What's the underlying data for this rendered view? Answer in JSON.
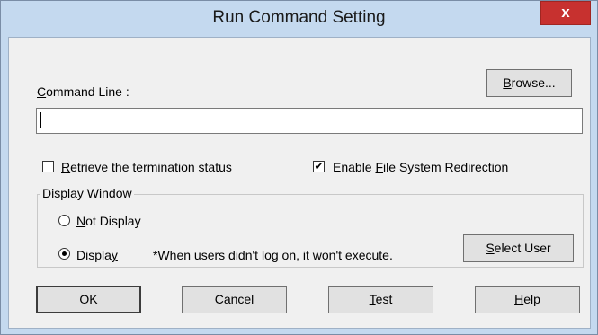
{
  "window": {
    "title": "Run Command Setting",
    "close_glyph": "x",
    "close_icon": "close-icon"
  },
  "command": {
    "label_mnemonic": "C",
    "label_rest": "ommand Line :",
    "value": ""
  },
  "browse": {
    "mnemonic": "B",
    "rest": "rowse..."
  },
  "options": {
    "retrieve": {
      "mnemonic": "R",
      "rest": "etrieve the termination status",
      "checked": false
    },
    "redirect": {
      "pre": "Enable ",
      "mnemonic": "F",
      "rest": "ile System Redirection",
      "checked": true,
      "check_glyph": "✔"
    }
  },
  "display_window": {
    "title": "Display Window",
    "not_display": {
      "mnemonic": "N",
      "rest": "ot Display",
      "selected": false
    },
    "display": {
      "pre": "Displa",
      "mnemonic": "y",
      "selected": true
    },
    "note": "*When users didn't log on, it won't execute.",
    "select_user": {
      "mnemonic": "S",
      "rest": "elect User"
    }
  },
  "buttons": {
    "ok": "OK",
    "cancel": "Cancel",
    "test": {
      "mnemonic": "T",
      "rest": "est"
    },
    "help": {
      "mnemonic": "H",
      "rest": "elp"
    }
  }
}
